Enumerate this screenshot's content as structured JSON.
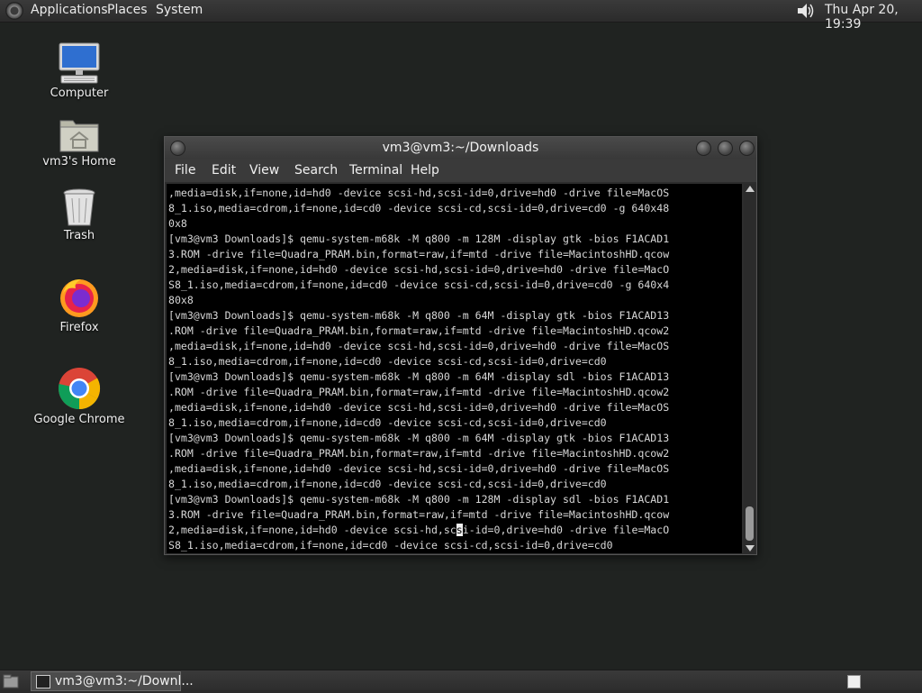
{
  "top_panel": {
    "menus": [
      "Applications",
      "Places",
      "System"
    ],
    "clock": "Thu Apr 20, 19:39"
  },
  "desktop": {
    "icons": [
      {
        "label": "Computer",
        "icon": "computer-icon"
      },
      {
        "label": "vm3's Home",
        "icon": "home-folder-icon"
      },
      {
        "label": "Trash",
        "icon": "trash-icon"
      },
      {
        "label": "Firefox",
        "icon": "firefox-icon"
      },
      {
        "label": "Google Chrome",
        "icon": "chrome-icon"
      }
    ]
  },
  "terminal": {
    "title": "vm3@vm3:~/Downloads",
    "menu": [
      "File",
      "Edit",
      "View",
      "Search",
      "Terminal",
      "Help"
    ],
    "lines": [
      ",media=disk,if=none,id=hd0 -device scsi-hd,scsi-id=0,drive=hd0 -drive file=MacOS",
      "8_1.iso,media=cdrom,if=none,id=cd0 -device scsi-cd,scsi-id=0,drive=cd0 -g 640x48",
      "0x8",
      "[vm3@vm3 Downloads]$ qemu-system-m68k -M q800 -m 128M -display gtk -bios F1ACAD1",
      "3.ROM -drive file=Quadra_PRAM.bin,format=raw,if=mtd -drive file=MacintoshHD.qcow",
      "2,media=disk,if=none,id=hd0 -device scsi-hd,scsi-id=0,drive=hd0 -drive file=MacO",
      "S8_1.iso,media=cdrom,if=none,id=cd0 -device scsi-cd,scsi-id=0,drive=cd0 -g 640x4",
      "80x8",
      "[vm3@vm3 Downloads]$ qemu-system-m68k -M q800 -m 64M -display gtk -bios F1ACAD13",
      ".ROM -drive file=Quadra_PRAM.bin,format=raw,if=mtd -drive file=MacintoshHD.qcow2",
      ",media=disk,if=none,id=hd0 -device scsi-hd,scsi-id=0,drive=hd0 -drive file=MacOS",
      "8_1.iso,media=cdrom,if=none,id=cd0 -device scsi-cd,scsi-id=0,drive=cd0",
      "[vm3@vm3 Downloads]$ qemu-system-m68k -M q800 -m 64M -display sdl -bios F1ACAD13",
      ".ROM -drive file=Quadra_PRAM.bin,format=raw,if=mtd -drive file=MacintoshHD.qcow2",
      ",media=disk,if=none,id=hd0 -device scsi-hd,scsi-id=0,drive=hd0 -drive file=MacOS",
      "8_1.iso,media=cdrom,if=none,id=cd0 -device scsi-cd,scsi-id=0,drive=cd0",
      "[vm3@vm3 Downloads]$ qemu-system-m68k -M q800 -m 64M -display gtk -bios F1ACAD13",
      ".ROM -drive file=Quadra_PRAM.bin,format=raw,if=mtd -drive file=MacintoshHD.qcow2",
      ",media=disk,if=none,id=hd0 -device scsi-hd,scsi-id=0,drive=hd0 -drive file=MacOS",
      "8_1.iso,media=cdrom,if=none,id=cd0 -device scsi-cd,scsi-id=0,drive=cd0",
      "[vm3@vm3 Downloads]$ qemu-system-m68k -M q800 -m 128M -display sdl -bios F1ACAD1",
      "3.ROM -drive file=Quadra_PRAM.bin,format=raw,if=mtd -drive file=MacintoshHD.qcow",
      "2,media=disk,if=none,id=hd0 -device scsi-hd,scsi-id=0,drive=hd0 -drive file=MacO",
      "S8_1.iso,media=cdrom,if=none,id=cd0 -device scsi-cd,scsi-id=0,drive=cd0"
    ]
  },
  "taskbar": {
    "task_label": "vm3@vm3:~/Downl..."
  }
}
